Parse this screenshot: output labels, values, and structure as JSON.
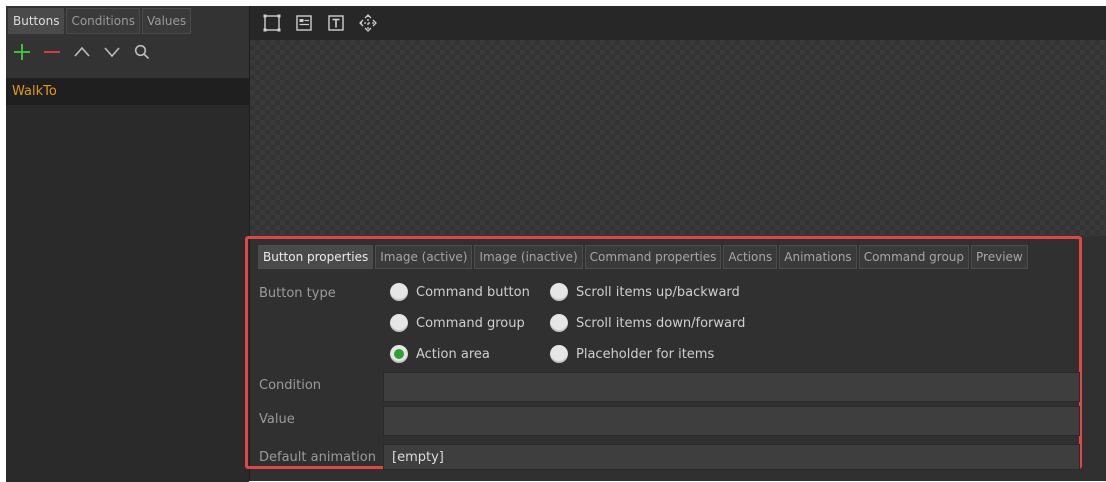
{
  "left_panel": {
    "tabs": [
      "Buttons",
      "Conditions",
      "Values"
    ],
    "list_items": [
      "WalkTo"
    ]
  },
  "properties": {
    "tabs": [
      "Button properties",
      "Image (active)",
      "Image (inactive)",
      "Command properties",
      "Actions",
      "Animations",
      "Command group",
      "Preview"
    ],
    "button_type_label": "Button type",
    "radio_options": [
      {
        "label": "Command button",
        "checked": false
      },
      {
        "label": "Scroll items up/backward",
        "checked": false
      },
      {
        "label": "Command group",
        "checked": false
      },
      {
        "label": "Scroll items down/forward",
        "checked": false
      },
      {
        "label": "Action area",
        "checked": true
      },
      {
        "label": "Placeholder for items",
        "checked": false
      }
    ],
    "condition_label": "Condition",
    "condition_value": "",
    "value_label": "Value",
    "value_value": "",
    "default_animation_label": "Default animation",
    "default_animation_value": "[empty]"
  },
  "colors": {
    "accent_highlight": "#e04646",
    "list_item_text": "#e19a14",
    "add_icon": "#3fbf3f",
    "remove_icon": "#d23c3c",
    "radio_checked": "#2ea12e"
  }
}
